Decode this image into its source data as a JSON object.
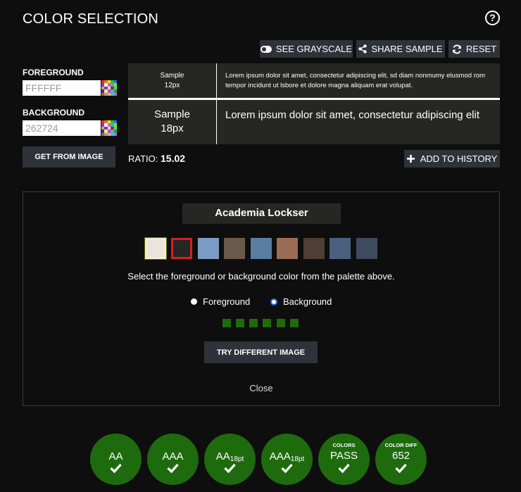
{
  "header": {
    "title": "COLOR SELECTION",
    "help_icon": "?"
  },
  "toolbar": {
    "grayscale_label": "SEE GRAYSCALE",
    "share_label": "SHARE SAMPLE",
    "reset_label": "RESET"
  },
  "inputs": {
    "foreground_label": "FOREGROUND",
    "foreground_value": "FFFFFF",
    "background_label": "BACKGROUND",
    "background_value": "262724"
  },
  "get_from_image_label": "GET FROM IMAGE",
  "samples": {
    "small_label_1": "Sample",
    "small_label_2": "12px",
    "small_text": "Lorem ipsum dolor sit amet, consectetur adipiscing elit, sd diam nonmumy elusmod rom tempor incidunt ut lsbore et dolore magna aliquam erat volupat.",
    "large_label_1": "Sample",
    "large_label_2": "18px",
    "large_text": "Lorem ipsum dolor sit amet, consectetur adipiscing elit"
  },
  "ratio": {
    "label": "RATIO:",
    "value": "15.02"
  },
  "add_history_label": "ADD TO HISTORY",
  "panel": {
    "image_title": "Academia Lockser",
    "palette": [
      "#eae5dc",
      "#262724",
      "#7a9cc4",
      "#6b5a4c",
      "#5a7da4",
      "#9a6d55",
      "#4e3e33",
      "#4a6080",
      "#3e4a5e"
    ],
    "instructions": "Select the foreground or background color from the palette above.",
    "radio_foreground": "Foreground",
    "radio_background": "Background",
    "selected_mode": "Background",
    "try_label": "TRY DIFFERENT IMAGE",
    "close_label": "Close"
  },
  "results": [
    {
      "label": "AA",
      "suffix": "",
      "top": "",
      "status": "pass"
    },
    {
      "label": "AAA",
      "suffix": "",
      "top": "",
      "status": "pass"
    },
    {
      "label": "AA",
      "suffix": "18pt",
      "top": "",
      "status": "pass"
    },
    {
      "label": "AAA",
      "suffix": "18pt",
      "top": "",
      "status": "pass"
    },
    {
      "label": "PASS",
      "suffix": "",
      "top": "COLORS",
      "status": "pass"
    },
    {
      "label": "652",
      "suffix": "",
      "top": "COLOR DIFF",
      "status": "pass"
    }
  ],
  "colors": {
    "button_bg": "#2e323a",
    "pass_green": "#1e6b0e",
    "sample_bg": "#262724"
  }
}
